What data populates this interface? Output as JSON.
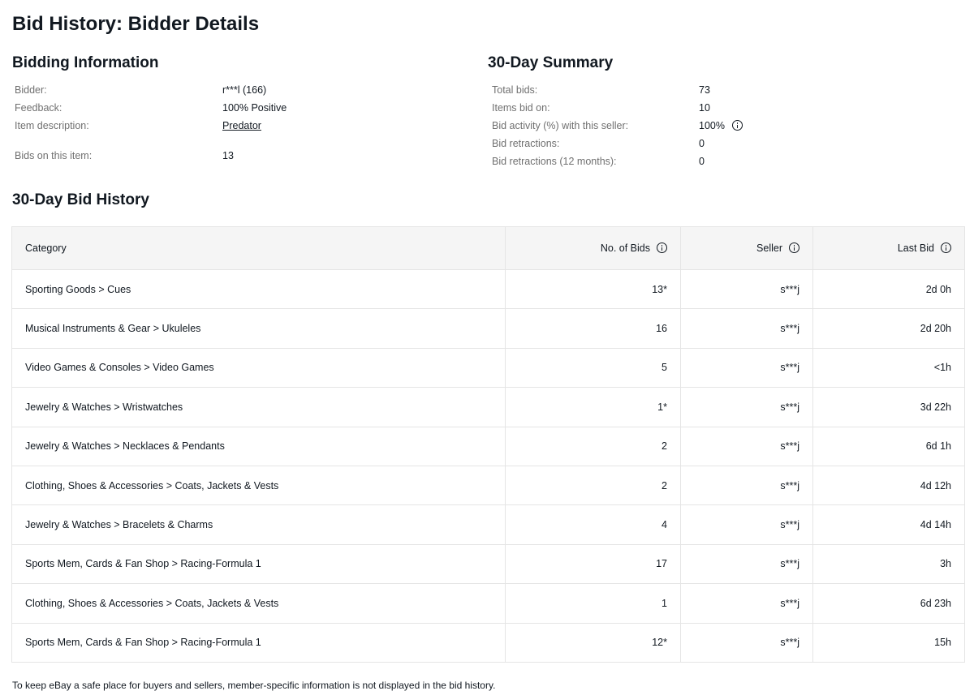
{
  "page_title": "Bid History: Bidder Details",
  "bidding_information": {
    "heading": "Bidding Information",
    "bidder_label": "Bidder:",
    "bidder_value": "r***l (166)",
    "feedback_label": "Feedback:",
    "feedback_value": "100% Positive",
    "item_description_label": "Item description:",
    "item_description_value": "Predator",
    "bids_on_item_label": "Bids on this item:",
    "bids_on_item_value": "13"
  },
  "summary": {
    "heading": "30-Day Summary",
    "total_bids_label": "Total bids:",
    "total_bids_value": "73",
    "items_bid_on_label": "Items bid on:",
    "items_bid_on_value": "10",
    "bid_activity_label": "Bid activity (%) with this seller:",
    "bid_activity_value": "100%",
    "bid_retractions_label": "Bid retractions:",
    "bid_retractions_value": "0",
    "bid_retractions_12m_label": "Bid retractions (12 months):",
    "bid_retractions_12m_value": "0"
  },
  "history": {
    "heading": "30-Day Bid History",
    "columns": [
      "Category",
      "No. of Bids",
      "Seller",
      "Last Bid"
    ],
    "rows": [
      {
        "category": "Sporting Goods > Cues",
        "bids": "13*",
        "seller": "s***j",
        "last_bid": "2d 0h"
      },
      {
        "category": "Musical Instruments & Gear > Ukuleles",
        "bids": "16",
        "seller": "s***j",
        "last_bid": "2d 20h"
      },
      {
        "category": "Video Games & Consoles > Video Games",
        "bids": "5",
        "seller": "s***j",
        "last_bid": "<1h"
      },
      {
        "category": "Jewelry & Watches > Wristwatches",
        "bids": "1*",
        "seller": "s***j",
        "last_bid": "3d 22h"
      },
      {
        "category": "Jewelry & Watches > Necklaces & Pendants",
        "bids": "2",
        "seller": "s***j",
        "last_bid": "6d 1h"
      },
      {
        "category": "Clothing, Shoes & Accessories > Coats, Jackets & Vests",
        "bids": "2",
        "seller": "s***j",
        "last_bid": "4d 12h"
      },
      {
        "category": "Jewelry & Watches > Bracelets & Charms",
        "bids": "4",
        "seller": "s***j",
        "last_bid": "4d 14h"
      },
      {
        "category": "Sports Mem, Cards & Fan Shop > Racing-Formula 1",
        "bids": "17",
        "seller": "s***j",
        "last_bid": "3h"
      },
      {
        "category": "Clothing, Shoes & Accessories > Coats, Jackets & Vests",
        "bids": "1",
        "seller": "s***j",
        "last_bid": "6d 23h"
      },
      {
        "category": "Sports Mem, Cards & Fan Shop > Racing-Formula 1",
        "bids": "12*",
        "seller": "s***j",
        "last_bid": "15h"
      }
    ]
  },
  "footer_text": "To keep eBay a safe place for buyers and sellers, member-specific information is not displayed in the bid history."
}
